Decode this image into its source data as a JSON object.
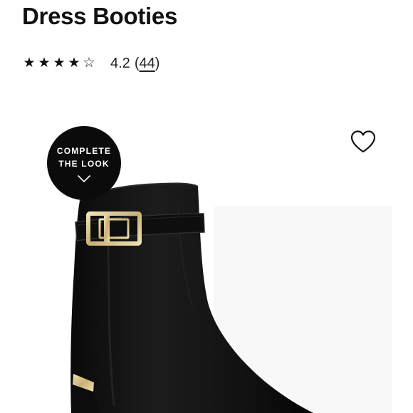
{
  "product": {
    "title": "Dress Booties"
  },
  "rating": {
    "stars": [
      "★",
      "★",
      "★",
      "★",
      "☆"
    ],
    "value": "4.2",
    "count_open": "(",
    "count": "44",
    "count_close": ")"
  },
  "complete_the_look": {
    "line1": "COMPLETE",
    "line2": "THE LOOK",
    "icon": "chevron-down-icon"
  },
  "wishlist": {
    "icon": "heart-outline-icon"
  },
  "product_image": {
    "subject": "black leather ankle boot with gold buckle strap",
    "colors": {
      "leather": "#141414",
      "hardware": "#d8c48e",
      "backdrop": "#f7f7f7"
    }
  }
}
